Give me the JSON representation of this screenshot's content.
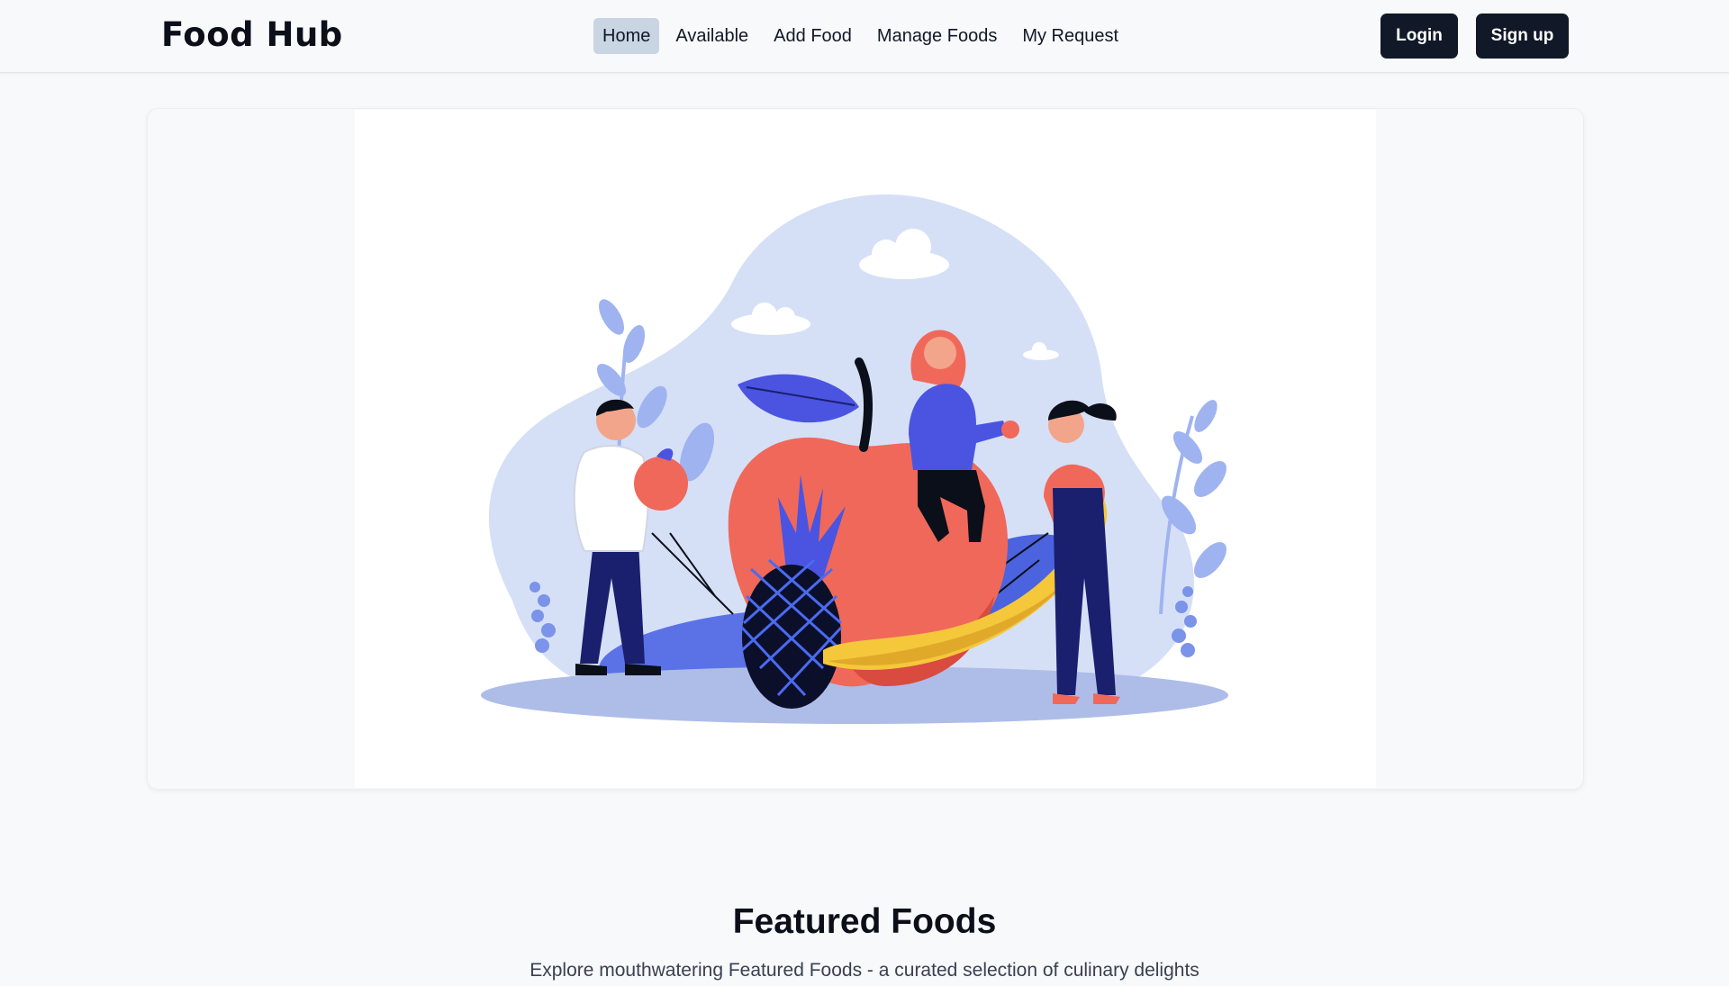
{
  "brand": {
    "name": "Food Hub"
  },
  "nav": {
    "items": [
      {
        "label": "Home",
        "active": true
      },
      {
        "label": "Available",
        "active": false
      },
      {
        "label": "Add Food",
        "active": false
      },
      {
        "label": "Manage Foods",
        "active": false
      },
      {
        "label": "My Request",
        "active": false
      }
    ]
  },
  "auth": {
    "login_label": "Login",
    "signup_label": "Sign up"
  },
  "hero": {
    "illustration": "people-with-giant-fruits-illustration"
  },
  "featured": {
    "title": "Featured Foods",
    "subtitle": "Explore mouthwatering Featured Foods - a curated selection of culinary delights"
  },
  "colors": {
    "primary_button": "#111827",
    "active_nav": "#c9d5e3",
    "apple": "#f0685a",
    "banana": "#f5c73b",
    "accent_blue": "#4a54e1",
    "navy": "#1a1f6e",
    "blob": "#d5e0f7"
  }
}
